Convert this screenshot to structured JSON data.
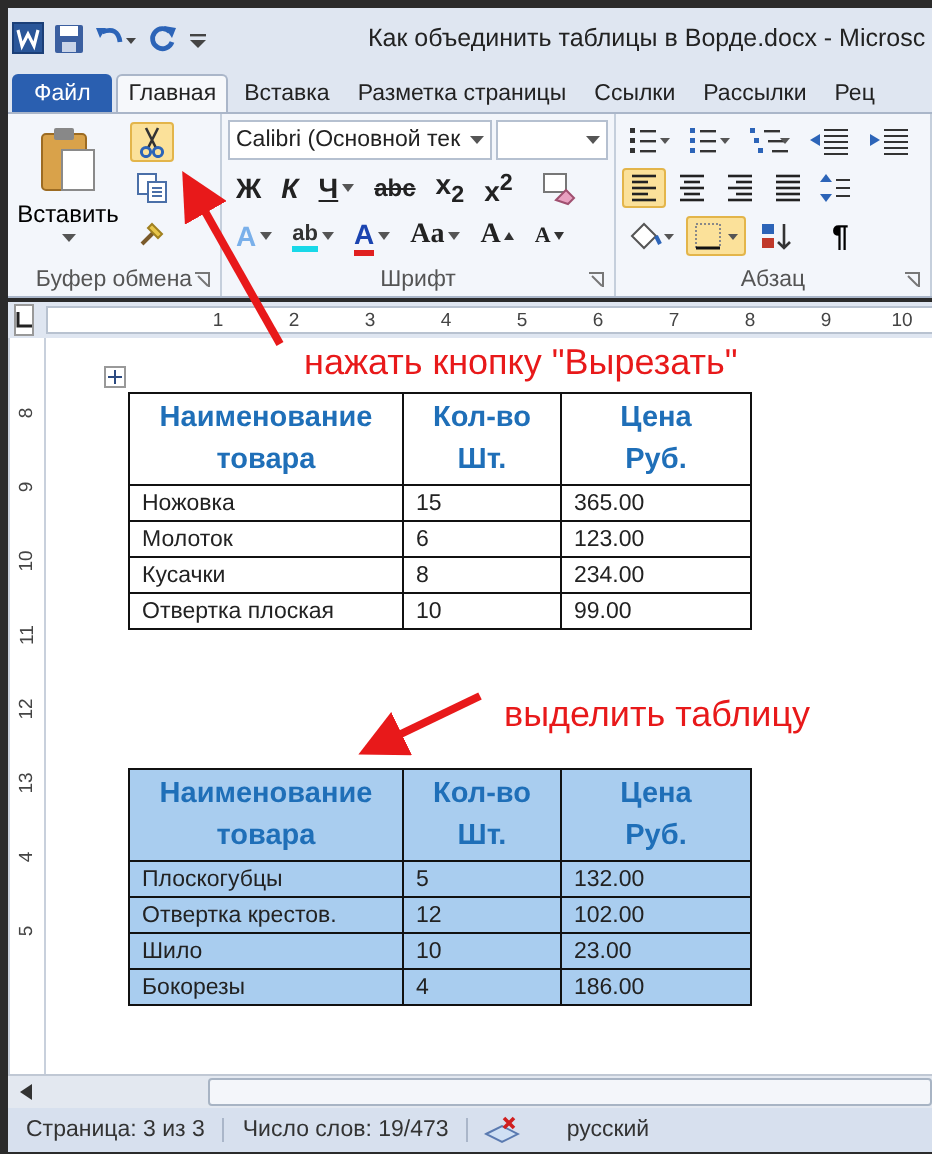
{
  "title_bar": {
    "title": "Как объединить таблицы в Ворде.docx  -  Microsc"
  },
  "tabs": [
    {
      "label": "Файл",
      "kind": "file",
      "selected": false
    },
    {
      "label": "Главная",
      "kind": "tab",
      "selected": true
    },
    {
      "label": "Вставка",
      "kind": "tab",
      "selected": false
    },
    {
      "label": "Разметка страницы",
      "kind": "tab",
      "selected": false
    },
    {
      "label": "Ссылки",
      "kind": "tab",
      "selected": false
    },
    {
      "label": "Рассылки",
      "kind": "tab",
      "selected": false
    },
    {
      "label": "Рец",
      "kind": "tab",
      "selected": false
    }
  ],
  "clipboard": {
    "paste_label": "Вставить",
    "cut_selected": true,
    "group_label": "Буфер обмена"
  },
  "font": {
    "name": "Calibri (Основной тек",
    "group_label": "Шрифт",
    "row1": [
      {
        "label": "Ж",
        "kind": "bold",
        "dropdown": false
      },
      {
        "label": "К",
        "kind": "italic",
        "dropdown": false
      },
      {
        "label": "Ч",
        "kind": "underline",
        "dropdown": true
      },
      {
        "label": "abc",
        "kind": "strike",
        "dropdown": false
      },
      {
        "label": "x$_{2}$",
        "kind": "plain",
        "dropdown": false
      },
      {
        "label": "x$^{2}$",
        "kind": "plain",
        "dropdown": false
      }
    ],
    "row2": [
      {
        "label": "A",
        "kind": "effects",
        "dropdown": true
      },
      {
        "label": "ab",
        "kind": "highlight",
        "dropdown": true
      },
      {
        "label": "A",
        "kind": "color",
        "dropdown": true
      },
      {
        "label": "Aa",
        "kind": "serif",
        "dropdown": true
      },
      {
        "label": "A",
        "kind": "grow",
        "dropdown": false
      },
      {
        "label": "A",
        "kind": "shrink",
        "dropdown": false
      }
    ]
  },
  "paragraph": {
    "group_label": "Абзац",
    "row1": [
      {
        "kind": "bullets",
        "selected": false
      },
      {
        "kind": "numbering",
        "selected": false
      },
      {
        "kind": "multilevel",
        "selected": false
      },
      {
        "kind": "outdent",
        "selected": false
      },
      {
        "kind": "indent",
        "selected": false
      }
    ],
    "row2": [
      {
        "kind": "align-left",
        "selected": true
      },
      {
        "kind": "align-center",
        "selected": false
      },
      {
        "kind": "align-right",
        "selected": false
      },
      {
        "kind": "justify",
        "selected": false
      },
      {
        "kind": "spacing",
        "selected": false
      }
    ],
    "row3": [
      {
        "kind": "shading",
        "selected": false
      },
      {
        "kind": "borders",
        "selected": true
      },
      {
        "kind": "sort",
        "selected": false
      }
    ],
    "pilcrow": "¶"
  },
  "ruler": {
    "h_numbers": [
      "1",
      "2",
      "3",
      "4",
      "5",
      "6",
      "7",
      "8",
      "9",
      "10"
    ],
    "v_numbers": [
      "8",
      "9",
      "10",
      "11",
      "12",
      "13",
      "4",
      "5"
    ]
  },
  "annotations": [
    {
      "text": "нажать кнопку \"Вырезать\""
    },
    {
      "text": "выделить таблицу"
    }
  ],
  "tables": [
    {
      "selected": false,
      "columns": [
        "Наименование товара",
        "Кол-во Шт.",
        "Цена Руб."
      ],
      "rows": [
        [
          "Ножовка",
          "15",
          "365.00"
        ],
        [
          "Молоток",
          "6",
          "123.00"
        ],
        [
          "Кусачки",
          "8",
          "234.00"
        ],
        [
          "Отвертка плоская",
          "10",
          "99.00"
        ]
      ]
    },
    {
      "selected": true,
      "columns": [
        "Наименование товара",
        "Кол-во Шт.",
        "Цена Руб."
      ],
      "rows": [
        [
          "Плоскогубцы",
          "5",
          "132.00"
        ],
        [
          "Отвертка крестов.",
          "12",
          "102.00"
        ],
        [
          "Шило",
          "10",
          "23.00"
        ],
        [
          "Бокорезы",
          "4",
          "186.00"
        ]
      ]
    }
  ],
  "status_bar": {
    "page": "Страница: 3 из 3",
    "words": "Число слов: 19/473",
    "language": "русский"
  }
}
